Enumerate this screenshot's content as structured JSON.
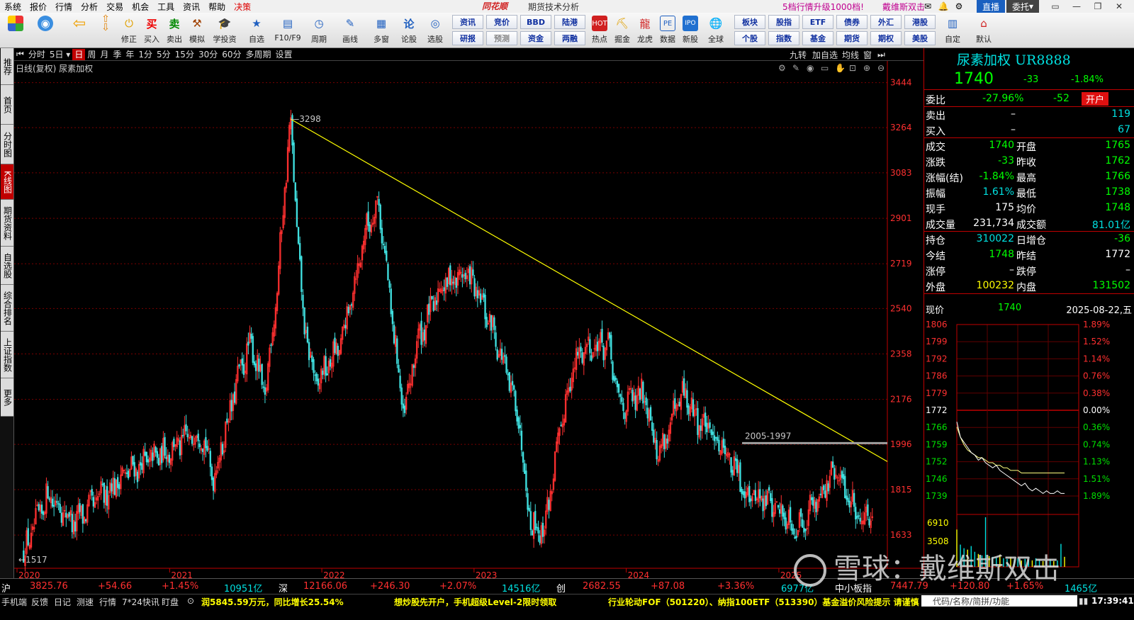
{
  "menu": {
    "items": [
      "系统",
      "报价",
      "行情",
      "分析",
      "交易",
      "机会",
      "工具",
      "资讯",
      "帮助",
      "决策"
    ],
    "brand": "同花顺",
    "app_title": "期货技术分析",
    "promo": "5档行情升级1000档!",
    "user": "戴维斯双击",
    "live_label": "直播",
    "entrust_label": "委托"
  },
  "toolbar": {
    "left_buttons": [
      {
        "label": "",
        "icon": "app-grid-icon"
      },
      {
        "label": "",
        "icon": "robot-icon"
      },
      {
        "label": "",
        "icon": "back-arrow-icon"
      },
      {
        "label": "修正",
        "icon": "up-down-arrows-icon"
      },
      {
        "label": "买入",
        "icon": "buy-icon"
      },
      {
        "label": "卖出",
        "icon": "sell-icon"
      },
      {
        "label": "模拟",
        "icon": "gavel-icon"
      },
      {
        "label": "学投资",
        "icon": "cap-icon"
      },
      {
        "label": "自选",
        "icon": "star-icon"
      },
      {
        "label": "F10/F9",
        "icon": "f10-icon"
      },
      {
        "label": "周期",
        "icon": "cycle-icon"
      },
      {
        "label": "画线",
        "icon": "pencil-icon"
      },
      {
        "label": "多窗",
        "icon": "windows-icon"
      },
      {
        "label": "论股",
        "icon": "chat-icon"
      },
      {
        "label": "选股",
        "icon": "select-icon"
      }
    ],
    "grid_top": [
      "资讯",
      "竞价",
      "BBD",
      "陆港"
    ],
    "grid_bottom": [
      "研报",
      "预测",
      "资金",
      "两融"
    ],
    "mid_buttons": [
      {
        "label": "热点",
        "icon": "hot-icon"
      },
      {
        "label": "掘金",
        "icon": "gold-icon"
      },
      {
        "label": "龙虎",
        "icon": "dragon-icon"
      },
      {
        "label": "数据",
        "icon": "pe-icon"
      },
      {
        "label": "新股",
        "icon": "ipo-icon"
      },
      {
        "label": "全球",
        "icon": "globe-icon"
      }
    ],
    "grid2_top": [
      "板块",
      "股指",
      "ETF",
      "债券",
      "外汇",
      "港股"
    ],
    "grid2_bottom": [
      "个股",
      "指数",
      "基金",
      "期货",
      "期权",
      "美股"
    ],
    "right_buttons": [
      {
        "label": "自定",
        "icon": "custom-icon"
      },
      {
        "label": "默认",
        "icon": "home-icon"
      }
    ]
  },
  "vtabs": [
    "推荐",
    "首页",
    "分时图",
    "K线图",
    "期货资料",
    "自选股",
    "综合排名",
    "上证指数",
    "更多"
  ],
  "periodbar": {
    "items": [
      "分时",
      "5日",
      "日",
      "周",
      "月",
      "季",
      "年",
      "1分",
      "5分",
      "15分",
      "30分",
      "60分",
      "多周期",
      "设置"
    ],
    "active": "日",
    "right_items": [
      "九转",
      "加自选",
      "均线",
      "窗"
    ]
  },
  "chart": {
    "title": "日线(复权) 尿素加权",
    "price_ticks": [
      "3444",
      "3264",
      "3083",
      "2901",
      "2719",
      "2540",
      "2358",
      "2176",
      "1996",
      "1815",
      "1633"
    ],
    "year_labels": [
      "2020",
      "2021",
      "2022",
      "2023",
      "2024",
      "2025"
    ],
    "label_high": "3298",
    "label_low": "1517",
    "label_range": "2005-1997"
  },
  "chart_data": {
    "type": "candlestick",
    "title": "日线(复权) 尿素加权",
    "ylim": [
      1517,
      3444
    ],
    "y_ticks": [
      3444,
      3264,
      3083,
      2901,
      2719,
      2540,
      2358,
      2176,
      1996,
      1815,
      1633
    ],
    "x_labels": [
      "2020",
      "2021",
      "2022",
      "2023",
      "2024",
      "2025"
    ],
    "anchors": [
      {
        "date": "2020-01",
        "close": 1560
      },
      {
        "date": "2020-03",
        "close": 1800
      },
      {
        "date": "2020-05",
        "close": 1680
      },
      {
        "date": "2020-09",
        "close": 1880
      },
      {
        "date": "2020-12",
        "close": 1960
      },
      {
        "date": "2021-03",
        "close": 2050
      },
      {
        "date": "2021-04",
        "close": 1860
      },
      {
        "date": "2021-06",
        "close": 2280
      },
      {
        "date": "2021-07",
        "close": 2400
      },
      {
        "date": "2021-08",
        "close": 2180
      },
      {
        "date": "2021-09",
        "close": 2640
      },
      {
        "date": "2021-10",
        "close": 3298
      },
      {
        "date": "2021-11",
        "close": 2500
      },
      {
        "date": "2021-12",
        "close": 2230
      },
      {
        "date": "2022-02",
        "close": 2400
      },
      {
        "date": "2022-04",
        "close": 2860
      },
      {
        "date": "2022-05",
        "close": 2970
      },
      {
        "date": "2022-06",
        "close": 2520
      },
      {
        "date": "2022-07",
        "close": 2100
      },
      {
        "date": "2022-08",
        "close": 2400
      },
      {
        "date": "2022-10",
        "close": 2640
      },
      {
        "date": "2022-12",
        "close": 2680
      },
      {
        "date": "2023-02",
        "close": 2450
      },
      {
        "date": "2023-04",
        "close": 2120
      },
      {
        "date": "2023-05",
        "close": 1680
      },
      {
        "date": "2023-06",
        "close": 1650
      },
      {
        "date": "2023-08",
        "close": 2250
      },
      {
        "date": "2023-09",
        "close": 2380
      },
      {
        "date": "2023-11",
        "close": 2400
      },
      {
        "date": "2023-12",
        "close": 2150
      },
      {
        "date": "2024-02",
        "close": 2200
      },
      {
        "date": "2024-03",
        "close": 1950
      },
      {
        "date": "2024-05",
        "close": 2200
      },
      {
        "date": "2024-06",
        "close": 2100
      },
      {
        "date": "2024-08",
        "close": 2000
      },
      {
        "date": "2024-10",
        "close": 1800
      },
      {
        "date": "2024-12",
        "close": 1760
      },
      {
        "date": "2025-02",
        "close": 1660
      },
      {
        "date": "2025-04",
        "close": 1820
      },
      {
        "date": "2025-05",
        "close": 1880
      },
      {
        "date": "2025-07",
        "close": 1700
      },
      {
        "date": "2025-08",
        "close": 1740
      }
    ],
    "trendline": {
      "from": {
        "date": "2021-10",
        "value": 3298
      },
      "to": {
        "date": "2025-08",
        "value": 1960
      }
    },
    "hline": {
      "value": 2001,
      "label": "2005-1997"
    },
    "up_color": "#ff3030",
    "down_color": "#40e0e0",
    "trend_color": "#ffff00",
    "grid": true
  },
  "quote": {
    "title": "尿素加权 UR8888",
    "price": "1740",
    "change": "-33",
    "pct": "-1.84%",
    "weibi_label": "委比",
    "weibi_pct": "-27.96%",
    "weibi_val": "-52",
    "open_btn": "开户",
    "sell_label": "卖出",
    "sell_price": "–",
    "sell_vol": "119",
    "buy_label": "买入",
    "buy_price": "–",
    "buy_vol": "67",
    "rows": [
      {
        "l1": "成交",
        "v1": "1740",
        "c1": "g",
        "l2": "开盘",
        "v2": "1765",
        "c2": "g"
      },
      {
        "l1": "涨跌",
        "v1": "-33",
        "c1": "g",
        "l2": "昨收",
        "v2": "1762",
        "c2": "g"
      },
      {
        "l1": "涨幅(结)",
        "v1": "-1.84%",
        "c1": "g",
        "l2": "最高",
        "v2": "1766",
        "c2": "g"
      },
      {
        "l1": "振幅",
        "v1": "1.61%",
        "c1": "c",
        "l2": "最低",
        "v2": "1738",
        "c2": "g"
      },
      {
        "l1": "现手",
        "v1": "175",
        "c1": "w",
        "l2": "均价",
        "v2": "1748",
        "c2": "g"
      },
      {
        "l1": "成交量",
        "v1": "231,734",
        "c1": "w",
        "l2": "成交额",
        "v2": "81.01亿",
        "c2": "c"
      }
    ],
    "rows2": [
      {
        "l1": "持仓",
        "v1": "310022",
        "c1": "c",
        "l2": "日增仓",
        "v2": "-36",
        "c2": "g"
      },
      {
        "l1": "今结",
        "v1": "1748",
        "c1": "g",
        "l2": "昨结",
        "v2": "1772",
        "c2": "w"
      },
      {
        "l1": "涨停",
        "v1": "–",
        "c1": "w",
        "l2": "跌停",
        "v2": "–",
        "c2": "w"
      },
      {
        "l1": "外盘",
        "v1": "100232",
        "c1": "y",
        "l2": "内盘",
        "v2": "131502",
        "c2": "g"
      }
    ]
  },
  "mini": {
    "now_label": "现价",
    "now_val": "1740",
    "date": "2025-08-22,五",
    "left_ticks": [
      "1806",
      "1799",
      "1792",
      "1786",
      "1779",
      "1772",
      "1766",
      "1759",
      "1752",
      "1746",
      "1739"
    ],
    "right_ticks": [
      "1.89%",
      "1.52%",
      "1.14%",
      "0.76%",
      "0.38%",
      "0.00%",
      "0.36%",
      "0.74%",
      "1.13%",
      "1.51%",
      "1.89%"
    ],
    "vol_ticks": [
      "6910",
      "3508"
    ]
  },
  "mini_chart_data": {
    "type": "line",
    "ylim": [
      1739,
      1806
    ],
    "base": 1772,
    "price": [
      1768,
      1762,
      1760,
      1758,
      1756,
      1755,
      1753,
      1754,
      1752,
      1751,
      1750,
      1751,
      1749,
      1748,
      1747,
      1746,
      1745,
      1744,
      1743,
      1744,
      1742,
      1741,
      1742,
      1741,
      1740,
      1741,
      1740,
      1740,
      1741,
      1740,
      1740
    ],
    "avg": [
      1766,
      1762,
      1759,
      1757,
      1756,
      1755,
      1754,
      1754,
      1753,
      1752,
      1752,
      1751,
      1751,
      1750,
      1750,
      1749,
      1749,
      1749,
      1748,
      1748,
      1748,
      1748,
      1748,
      1748,
      1748,
      1748,
      1748,
      1748,
      1748,
      1748,
      1748
    ],
    "vol_max": 6910,
    "vol": [
      5200,
      3100,
      2600,
      2400,
      2900,
      2100,
      1800,
      1600,
      6910,
      1500,
      1400,
      1300,
      1700,
      1200,
      1100,
      1400,
      1000,
      1200,
      900,
      1100,
      1000,
      900,
      1200,
      1000,
      800,
      900,
      1100,
      800,
      900,
      3200,
      1400
    ]
  },
  "status": {
    "sh_label": "沪",
    "sh_val": "3825.76",
    "sh_chg": "+54.66",
    "sh_pct": "+1.45%",
    "sh_amt": "10951亿",
    "sz_label": "深",
    "sz_val": "12166.06",
    "sz_chg": "+246.30",
    "sz_pct": "+2.07%",
    "sz_amt": "14516亿",
    "cy_label": "创",
    "cy_val": "2682.55",
    "cy_chg": "+87.08",
    "cy_pct": "+3.36%",
    "cy_amt": "6977亿",
    "zx_label": "中小板指",
    "zx_val": "7447.79",
    "zx_chg": "+120.80",
    "zx_pct": "+1.65%",
    "zx_amt": "1465亿"
  },
  "bottom": {
    "tabs": [
      "手机端",
      "反馈",
      "日记",
      "测速",
      "行情",
      "7*24快讯",
      "盯盘"
    ],
    "ticker1": "润5845.59万元，同比增长25.54%",
    "ticker2": "想炒股先开户，手机超级Level-2限时领取",
    "ticker3": "行业轮动FOF（501220）、纳指100ETF（513390）基金溢价风险提示 请谨慎",
    "search_placeholder": "代码/名称/简拼/功能",
    "time": "17:39:41"
  },
  "watermark": "雪球：戴维斯双击"
}
